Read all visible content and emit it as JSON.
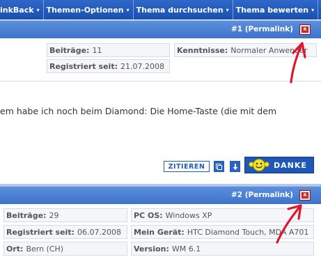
{
  "nav": {
    "items": [
      {
        "label": "inkBack"
      },
      {
        "label": "Themen-Optionen"
      },
      {
        "label": "Thema durchsuchen"
      },
      {
        "label": "Thema bewerten"
      }
    ],
    "arrow": "▾"
  },
  "post1": {
    "header": "#1 (Permalink)",
    "report_icon": "R",
    "info": {
      "beitraege_label": "Beiträge:",
      "beitraege_value": "11",
      "registriert_label": "Registriert seit:",
      "registriert_value": "21.07.2008",
      "kenntnisse_label": "Kenntnisse:",
      "kenntnisse_value": "Normaler Anwender"
    },
    "text": "em habe ich noch beim Diamond: Die Home-Taste (die mit dem",
    "buttons": {
      "quote": "ZITIEREN",
      "thanks": "DANKE"
    }
  },
  "post2": {
    "header": "#2 (Permalink)",
    "report_icon": "R",
    "info": {
      "beitraege_label": "Beiträge:",
      "beitraege_value": "29",
      "registriert_label": "Registriert seit:",
      "registriert_value": "06.07.2008",
      "ort_label": "Ort:",
      "ort_value": "Bern (CH)",
      "pcos_label": "PC OS:",
      "pcos_value": "Windows XP",
      "geraet_label": "Mein Gerät:",
      "geraet_value": "HTC Diamond Touch, MDA A701",
      "version_label": "Version:",
      "version_value": "WM 6.1"
    }
  },
  "colors": {
    "annotation": "#e0162b",
    "nav_bg": "#1a4fae",
    "header_bg": "#4a7fd2"
  }
}
